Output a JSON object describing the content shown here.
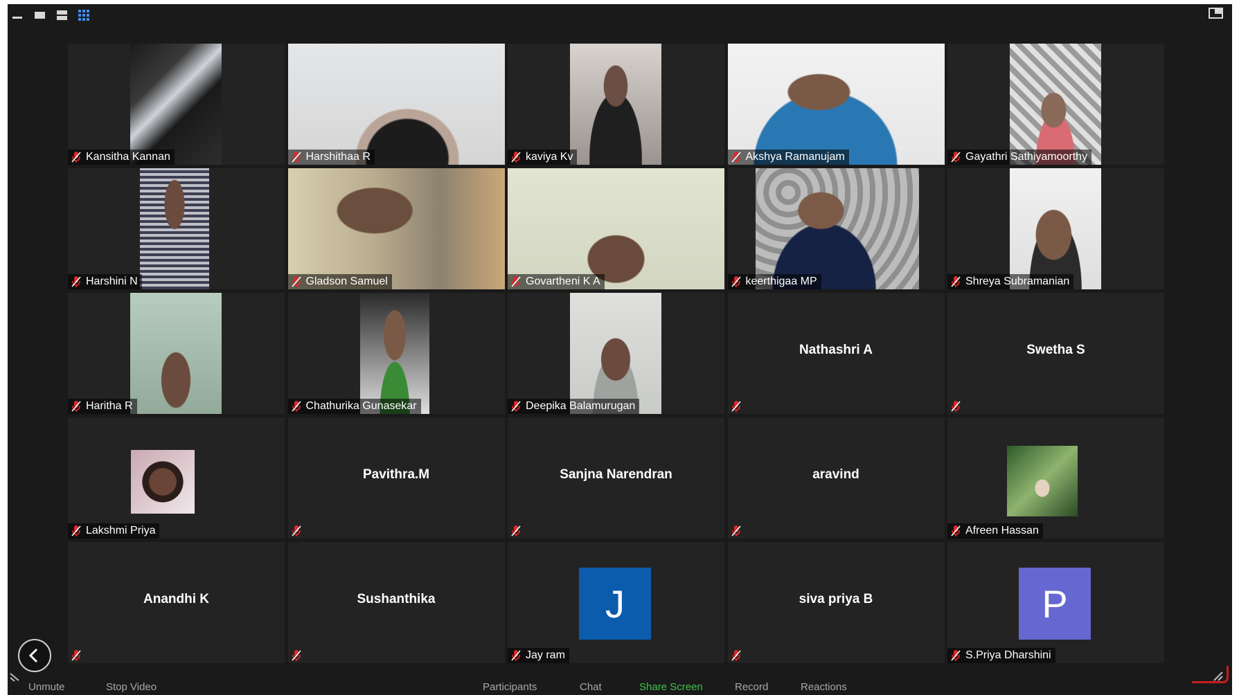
{
  "toolbar": {
    "unmute": "Unmute",
    "stop_video": "Stop Video",
    "participants": "Participants",
    "chat": "Chat",
    "share_screen": "Share Screen",
    "record": "Record",
    "reactions": "Reactions"
  },
  "colors": {
    "window_bg": "#1a1a1a",
    "tile_bg": "#232323",
    "mute_red": "#e02828",
    "share_green": "#3ec24a",
    "view_active": "#3f8ef0",
    "avatar_blue": "#0b5cad",
    "avatar_purple": "#6767d1"
  },
  "participants": [
    {
      "name": "Kansitha Kannan",
      "type": "video",
      "muted": true
    },
    {
      "name": "Harshithaa R",
      "type": "video",
      "muted": true
    },
    {
      "name": "kaviya Kv",
      "type": "video",
      "muted": true
    },
    {
      "name": "Akshya Ramanujam",
      "type": "video",
      "muted": true
    },
    {
      "name": "Gayathri Sathiyamoorthy",
      "type": "video",
      "muted": true
    },
    {
      "name": "Harshini N",
      "type": "video",
      "muted": true
    },
    {
      "name": "Gladson Samuel",
      "type": "video",
      "muted": true
    },
    {
      "name": "Govartheni K A",
      "type": "video",
      "muted": true
    },
    {
      "name": "keerthigaa MP",
      "type": "video",
      "muted": true
    },
    {
      "name": "Shreya Subramanian",
      "type": "video",
      "muted": true
    },
    {
      "name": "Haritha R",
      "type": "video",
      "muted": true
    },
    {
      "name": "Chathurika Gunasekar",
      "type": "video",
      "muted": true
    },
    {
      "name": "Deepika Balamurugan",
      "type": "video",
      "muted": true
    },
    {
      "name": "Nathashri A",
      "type": "name",
      "muted": true
    },
    {
      "name": "Swetha S",
      "type": "name",
      "muted": true
    },
    {
      "name": "Lakshmi Priya",
      "type": "photo",
      "muted": true
    },
    {
      "name": "Pavithra.M",
      "type": "name",
      "muted": true
    },
    {
      "name": "Sanjna Narendran",
      "type": "name",
      "muted": true
    },
    {
      "name": "aravind",
      "type": "name",
      "muted": true
    },
    {
      "name": "Afreen Hassan",
      "type": "photo",
      "muted": true
    },
    {
      "name": "Anandhi K",
      "type": "name",
      "muted": true
    },
    {
      "name": "Sushanthika",
      "type": "name",
      "muted": true
    },
    {
      "name": "Jay ram",
      "type": "initial",
      "initial": "J",
      "color": "#0b5cad",
      "muted": true
    },
    {
      "name": "siva priya B",
      "type": "name",
      "muted": true
    },
    {
      "name": "S.Priya Dharshini",
      "type": "initial",
      "initial": "P",
      "color": "#6767d1",
      "muted": true
    }
  ]
}
